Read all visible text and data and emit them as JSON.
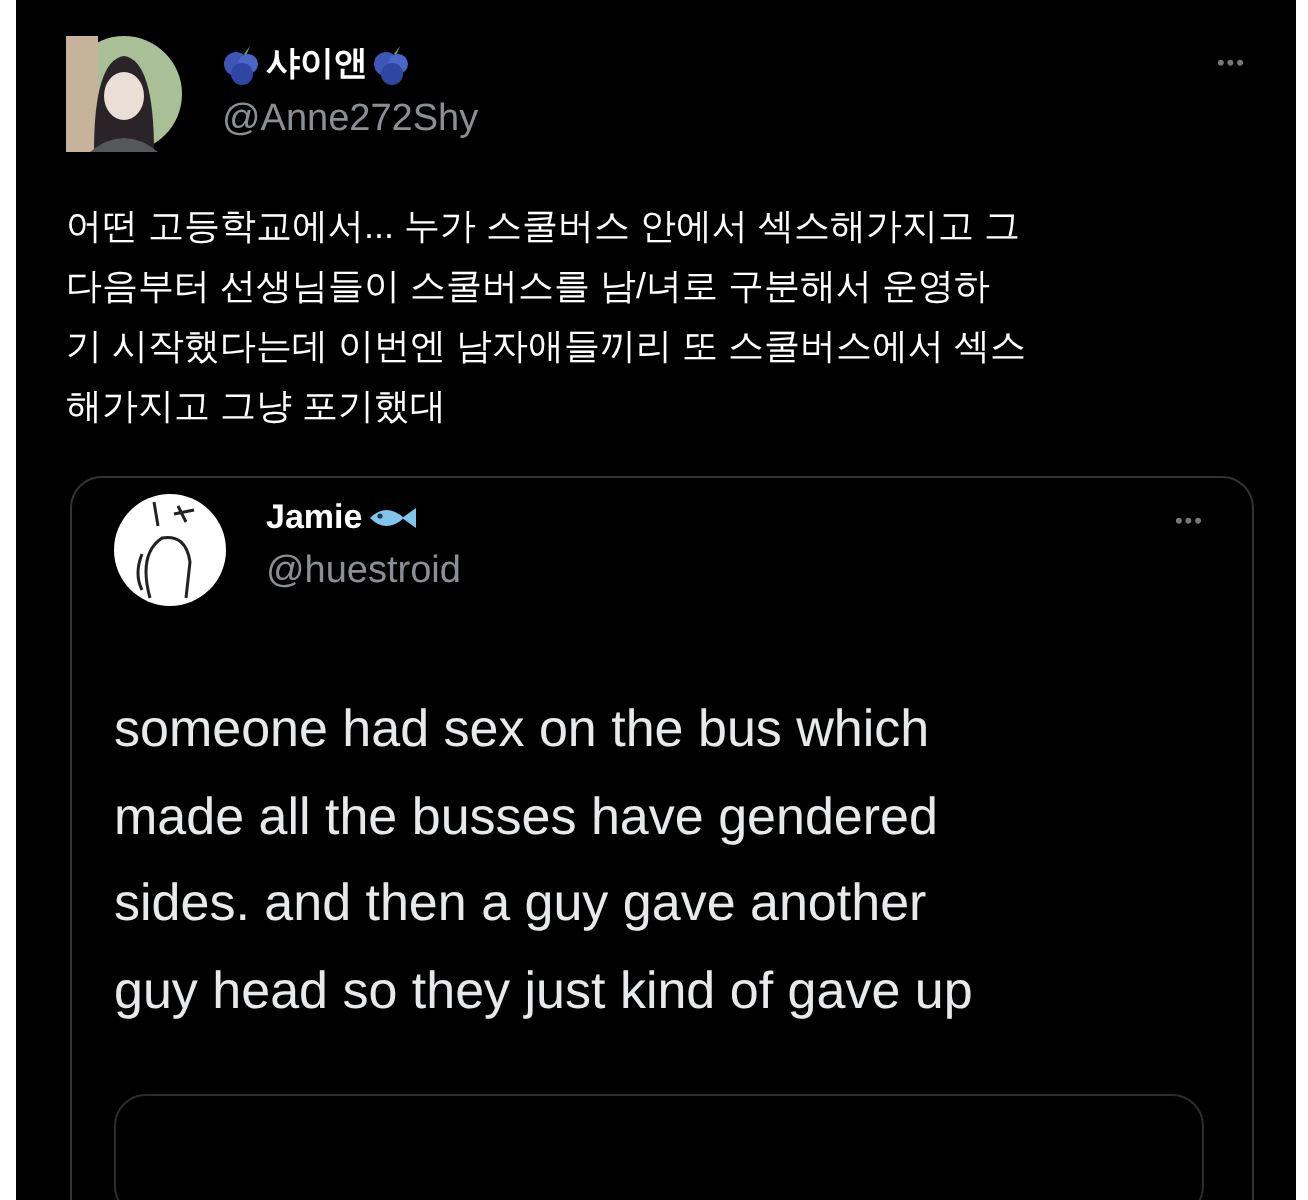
{
  "tweet": {
    "display_name": "샤이앤",
    "handle": "@Anne272Shy",
    "more": "•••",
    "text_lines": [
      "어떤 고등학교에서... 누가 스쿨버스 안에서 섹스해가지고 그",
      "다음부터 선생님들이 스쿨버스를 남/녀로 구분해서 운영하",
      "기 시작했다는데 이번엔 남자애들끼리 또 스쿨버스에서 섹스",
      "해가지고 그냥 포기했대"
    ]
  },
  "quoted_tweet": {
    "display_name": "Jamie",
    "handle": "@huestroid",
    "more": "•••",
    "text_lines": [
      "someone had sex on the bus which",
      "made all the busses have gendered",
      "sides. and then a guy gave another",
      "guy head so they just kind of gave up"
    ]
  }
}
